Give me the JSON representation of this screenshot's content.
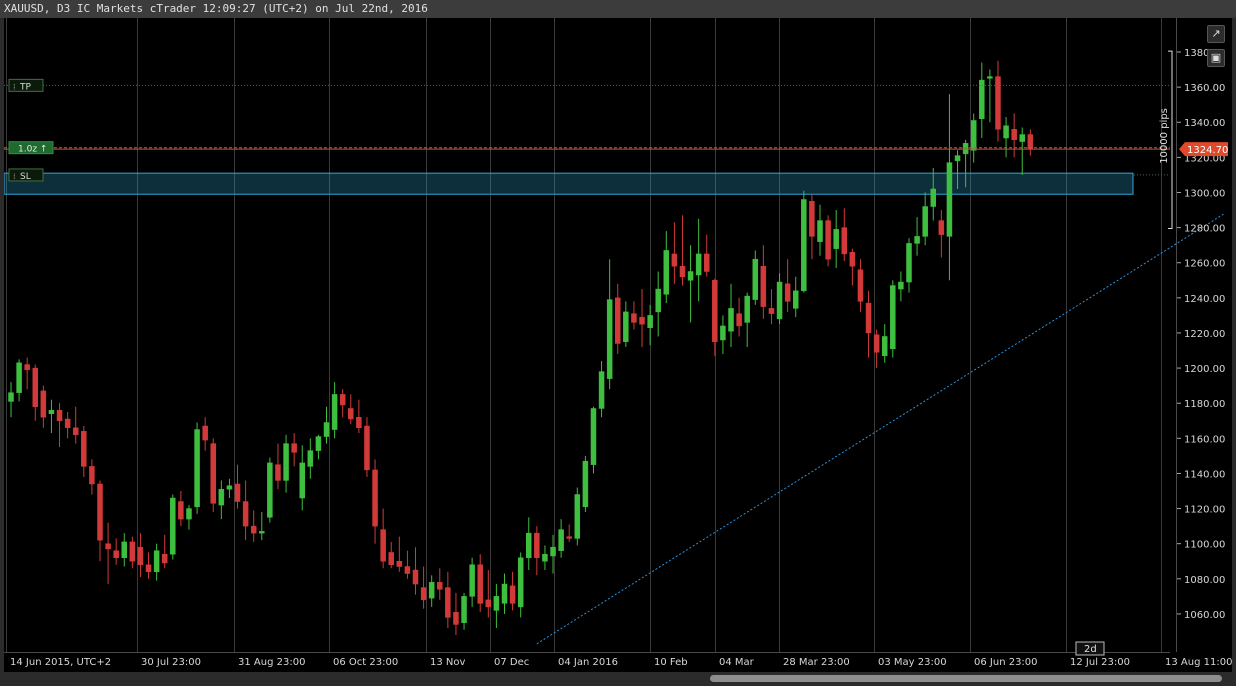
{
  "window": {
    "title": "XAUUSD, D3 IC Markets cTrader 12:09:27 (UTC+2) on Jul 22nd, 2016"
  },
  "colors": {
    "background": "#000000",
    "grid": "#3a3a3a",
    "bull": "#3fbf3f",
    "bear": "#d23a3a",
    "price_line": "#e04a2a",
    "trend": "#2f8fd8",
    "sl_zone": "#2ea8d8"
  },
  "price_axis": {
    "labels": [
      "1380.00",
      "1360.00",
      "1340.00",
      "1320.00",
      "1300.00",
      "1280.00",
      "1260.00",
      "1240.00",
      "1220.00",
      "1200.00",
      "1180.00",
      "1160.00",
      "1140.00",
      "1120.00",
      "1100.00",
      "1080.00",
      "1060.00"
    ],
    "current_price": "1324.70",
    "pips_label": "10000 pips"
  },
  "time_axis": {
    "labels": [
      "14 Jun 2015, UTC+2",
      "30 Jul 23:00",
      "31 Aug 23:00",
      "06 Oct 23:00",
      "13 Nov",
      "07 Dec",
      "04 Jan 2016",
      "10 Feb",
      "04 Mar",
      "28 Mar 23:00",
      "03 May 23:00",
      "06 Jun 23:00",
      "12 Jul 23:00",
      "13 Aug 11:00"
    ],
    "period_badge": "2d"
  },
  "orders": {
    "tp_label": "TP",
    "sl_label": "SL",
    "position_label": "1.0z ↑",
    "tp_price": 1361,
    "sl_top": 1311,
    "sl_bottom": 1299,
    "entry_price": 1325.5
  },
  "toolbar": {
    "popout_icon": "popout-icon",
    "camera_icon": "camera-icon"
  },
  "chart_data": {
    "type": "candlestick",
    "symbol": "XAUUSD",
    "timeframe": "D3",
    "ylim": [
      1045,
      1385
    ],
    "candles": [
      {
        "open": 1181,
        "high": 1192,
        "low": 1172,
        "close": 1186
      },
      {
        "open": 1186,
        "high": 1205,
        "low": 1181,
        "close": 1203
      },
      {
        "open": 1202,
        "high": 1206,
        "low": 1188,
        "close": 1199
      },
      {
        "open": 1200,
        "high": 1202,
        "low": 1170,
        "close": 1178
      },
      {
        "open": 1187,
        "high": 1190,
        "low": 1166,
        "close": 1172
      },
      {
        "open": 1174,
        "high": 1182,
        "low": 1163,
        "close": 1176
      },
      {
        "open": 1176,
        "high": 1180,
        "low": 1155,
        "close": 1170
      },
      {
        "open": 1171,
        "high": 1175,
        "low": 1160,
        "close": 1166
      },
      {
        "open": 1166,
        "high": 1178,
        "low": 1157,
        "close": 1162
      },
      {
        "open": 1164,
        "high": 1167,
        "low": 1138,
        "close": 1144
      },
      {
        "open": 1144,
        "high": 1148,
        "low": 1128,
        "close": 1134
      },
      {
        "open": 1134,
        "high": 1136,
        "low": 1090,
        "close": 1102
      },
      {
        "open": 1100,
        "high": 1112,
        "low": 1077,
        "close": 1097
      },
      {
        "open": 1096,
        "high": 1103,
        "low": 1088,
        "close": 1092
      },
      {
        "open": 1092,
        "high": 1106,
        "low": 1087,
        "close": 1101
      },
      {
        "open": 1101,
        "high": 1104,
        "low": 1086,
        "close": 1090
      },
      {
        "open": 1098,
        "high": 1106,
        "low": 1081,
        "close": 1088
      },
      {
        "open": 1088,
        "high": 1095,
        "low": 1080,
        "close": 1084
      },
      {
        "open": 1084,
        "high": 1100,
        "low": 1079,
        "close": 1096
      },
      {
        "open": 1094,
        "high": 1105,
        "low": 1086,
        "close": 1089
      },
      {
        "open": 1094,
        "high": 1128,
        "low": 1091,
        "close": 1126
      },
      {
        "open": 1124,
        "high": 1130,
        "low": 1110,
        "close": 1114
      },
      {
        "open": 1114,
        "high": 1122,
        "low": 1108,
        "close": 1120
      },
      {
        "open": 1121,
        "high": 1169,
        "low": 1117,
        "close": 1165
      },
      {
        "open": 1167,
        "high": 1172,
        "low": 1153,
        "close": 1159
      },
      {
        "open": 1157,
        "high": 1160,
        "low": 1118,
        "close": 1123
      },
      {
        "open": 1122,
        "high": 1136,
        "low": 1114,
        "close": 1131
      },
      {
        "open": 1131,
        "high": 1137,
        "low": 1126,
        "close": 1133
      },
      {
        "open": 1134,
        "high": 1145,
        "low": 1120,
        "close": 1124
      },
      {
        "open": 1124,
        "high": 1136,
        "low": 1102,
        "close": 1110
      },
      {
        "open": 1110,
        "high": 1119,
        "low": 1101,
        "close": 1106
      },
      {
        "open": 1106,
        "high": 1118,
        "low": 1102,
        "close": 1107
      },
      {
        "open": 1115,
        "high": 1149,
        "low": 1112,
        "close": 1146
      },
      {
        "open": 1145,
        "high": 1157,
        "low": 1131,
        "close": 1136
      },
      {
        "open": 1136,
        "high": 1162,
        "low": 1129,
        "close": 1157
      },
      {
        "open": 1157,
        "high": 1163,
        "low": 1144,
        "close": 1152
      },
      {
        "open": 1126,
        "high": 1156,
        "low": 1119,
        "close": 1146
      },
      {
        "open": 1144,
        "high": 1160,
        "low": 1137,
        "close": 1153
      },
      {
        "open": 1153,
        "high": 1162,
        "low": 1148,
        "close": 1161
      },
      {
        "open": 1161,
        "high": 1178,
        "low": 1157,
        "close": 1169
      },
      {
        "open": 1165,
        "high": 1192,
        "low": 1160,
        "close": 1185
      },
      {
        "open": 1185,
        "high": 1188,
        "low": 1172,
        "close": 1179
      },
      {
        "open": 1177,
        "high": 1185,
        "low": 1168,
        "close": 1171
      },
      {
        "open": 1172,
        "high": 1182,
        "low": 1163,
        "close": 1166
      },
      {
        "open": 1167,
        "high": 1172,
        "low": 1138,
        "close": 1142
      },
      {
        "open": 1142,
        "high": 1148,
        "low": 1100,
        "close": 1110
      },
      {
        "open": 1108,
        "high": 1120,
        "low": 1086,
        "close": 1090
      },
      {
        "open": 1095,
        "high": 1101,
        "low": 1086,
        "close": 1088
      },
      {
        "open": 1090,
        "high": 1104,
        "low": 1084,
        "close": 1087
      },
      {
        "open": 1087,
        "high": 1096,
        "low": 1080,
        "close": 1083
      },
      {
        "open": 1085,
        "high": 1098,
        "low": 1071,
        "close": 1077
      },
      {
        "open": 1075,
        "high": 1087,
        "low": 1063,
        "close": 1068
      },
      {
        "open": 1069,
        "high": 1082,
        "low": 1064,
        "close": 1078
      },
      {
        "open": 1078,
        "high": 1086,
        "low": 1068,
        "close": 1074
      },
      {
        "open": 1075,
        "high": 1084,
        "low": 1052,
        "close": 1058
      },
      {
        "open": 1061,
        "high": 1072,
        "low": 1048,
        "close": 1054
      },
      {
        "open": 1055,
        "high": 1072,
        "low": 1051,
        "close": 1070
      },
      {
        "open": 1070,
        "high": 1092,
        "low": 1064,
        "close": 1088
      },
      {
        "open": 1088,
        "high": 1094,
        "low": 1061,
        "close": 1066
      },
      {
        "open": 1068,
        "high": 1085,
        "low": 1058,
        "close": 1064
      },
      {
        "open": 1062,
        "high": 1077,
        "low": 1052,
        "close": 1070
      },
      {
        "open": 1066,
        "high": 1083,
        "low": 1060,
        "close": 1077
      },
      {
        "open": 1076,
        "high": 1084,
        "low": 1062,
        "close": 1066
      },
      {
        "open": 1064,
        "high": 1095,
        "low": 1058,
        "close": 1092
      },
      {
        "open": 1092,
        "high": 1115,
        "low": 1085,
        "close": 1106
      },
      {
        "open": 1106,
        "high": 1110,
        "low": 1082,
        "close": 1092
      },
      {
        "open": 1090,
        "high": 1099,
        "low": 1085,
        "close": 1094
      },
      {
        "open": 1093,
        "high": 1105,
        "low": 1083,
        "close": 1098
      },
      {
        "open": 1096,
        "high": 1114,
        "low": 1092,
        "close": 1108
      },
      {
        "open": 1104,
        "high": 1111,
        "low": 1101,
        "close": 1103
      },
      {
        "open": 1103,
        "high": 1132,
        "low": 1099,
        "close": 1128
      },
      {
        "open": 1121,
        "high": 1150,
        "low": 1118,
        "close": 1147
      },
      {
        "open": 1145,
        "high": 1178,
        "low": 1140,
        "close": 1177
      },
      {
        "open": 1177,
        "high": 1204,
        "low": 1172,
        "close": 1198
      },
      {
        "open": 1194,
        "high": 1262,
        "low": 1188,
        "close": 1239
      },
      {
        "open": 1240,
        "high": 1248,
        "low": 1208,
        "close": 1214
      },
      {
        "open": 1215,
        "high": 1238,
        "low": 1212,
        "close": 1232
      },
      {
        "open": 1231,
        "high": 1238,
        "low": 1222,
        "close": 1226
      },
      {
        "open": 1229,
        "high": 1245,
        "low": 1212,
        "close": 1225
      },
      {
        "open": 1223,
        "high": 1236,
        "low": 1213,
        "close": 1230
      },
      {
        "open": 1232,
        "high": 1255,
        "low": 1218,
        "close": 1245
      },
      {
        "open": 1242,
        "high": 1278,
        "low": 1237,
        "close": 1267
      },
      {
        "open": 1265,
        "high": 1283,
        "low": 1248,
        "close": 1258
      },
      {
        "open": 1258,
        "high": 1287,
        "low": 1247,
        "close": 1252
      },
      {
        "open": 1250,
        "high": 1270,
        "low": 1226,
        "close": 1255
      },
      {
        "open": 1253,
        "high": 1285,
        "low": 1238,
        "close": 1265
      },
      {
        "open": 1265,
        "high": 1276,
        "low": 1252,
        "close": 1255
      },
      {
        "open": 1250,
        "high": 1251,
        "low": 1207,
        "close": 1215
      },
      {
        "open": 1216,
        "high": 1230,
        "low": 1208,
        "close": 1224
      },
      {
        "open": 1221,
        "high": 1248,
        "low": 1212,
        "close": 1234
      },
      {
        "open": 1231,
        "high": 1240,
        "low": 1218,
        "close": 1224
      },
      {
        "open": 1226,
        "high": 1243,
        "low": 1212,
        "close": 1241
      },
      {
        "open": 1239,
        "high": 1267,
        "low": 1236,
        "close": 1262
      },
      {
        "open": 1258,
        "high": 1270,
        "low": 1228,
        "close": 1235
      },
      {
        "open": 1234,
        "high": 1245,
        "low": 1225,
        "close": 1231
      },
      {
        "open": 1228,
        "high": 1254,
        "low": 1225,
        "close": 1249
      },
      {
        "open": 1248,
        "high": 1262,
        "low": 1232,
        "close": 1238
      },
      {
        "open": 1234,
        "high": 1252,
        "low": 1229,
        "close": 1244
      },
      {
        "open": 1244,
        "high": 1301,
        "low": 1243,
        "close": 1296
      },
      {
        "open": 1295,
        "high": 1299,
        "low": 1262,
        "close": 1275
      },
      {
        "open": 1272,
        "high": 1293,
        "low": 1264,
        "close": 1284
      },
      {
        "open": 1284,
        "high": 1287,
        "low": 1258,
        "close": 1262
      },
      {
        "open": 1268,
        "high": 1290,
        "low": 1257,
        "close": 1279
      },
      {
        "open": 1280,
        "high": 1291,
        "low": 1261,
        "close": 1265
      },
      {
        "open": 1266,
        "high": 1268,
        "low": 1247,
        "close": 1258
      },
      {
        "open": 1256,
        "high": 1262,
        "low": 1232,
        "close": 1238
      },
      {
        "open": 1237,
        "high": 1244,
        "low": 1206,
        "close": 1220
      },
      {
        "open": 1219,
        "high": 1222,
        "low": 1200,
        "close": 1209
      },
      {
        "open": 1207,
        "high": 1225,
        "low": 1203,
        "close": 1218
      },
      {
        "open": 1211,
        "high": 1250,
        "low": 1206,
        "close": 1247
      },
      {
        "open": 1245,
        "high": 1255,
        "low": 1238,
        "close": 1249
      },
      {
        "open": 1249,
        "high": 1274,
        "low": 1243,
        "close": 1271
      },
      {
        "open": 1271,
        "high": 1286,
        "low": 1264,
        "close": 1275
      },
      {
        "open": 1275,
        "high": 1300,
        "low": 1270,
        "close": 1292
      },
      {
        "open": 1292,
        "high": 1314,
        "low": 1284,
        "close": 1302
      },
      {
        "open": 1284,
        "high": 1290,
        "low": 1263,
        "close": 1276
      },
      {
        "open": 1275,
        "high": 1356,
        "low": 1250,
        "close": 1317
      },
      {
        "open": 1318,
        "high": 1324,
        "low": 1302,
        "close": 1321
      },
      {
        "open": 1322,
        "high": 1330,
        "low": 1303,
        "close": 1328
      },
      {
        "open": 1324,
        "high": 1345,
        "low": 1317,
        "close": 1341
      },
      {
        "open": 1342,
        "high": 1374,
        "low": 1331,
        "close": 1364
      },
      {
        "open": 1365,
        "high": 1370,
        "low": 1340,
        "close": 1366
      },
      {
        "open": 1366,
        "high": 1375,
        "low": 1329,
        "close": 1336
      },
      {
        "open": 1331,
        "high": 1343,
        "low": 1320,
        "close": 1338
      },
      {
        "open": 1336,
        "high": 1345,
        "low": 1320,
        "close": 1330
      },
      {
        "open": 1329,
        "high": 1337,
        "low": 1310,
        "close": 1333
      },
      {
        "open": 1333,
        "high": 1336,
        "low": 1321,
        "close": 1325
      }
    ],
    "trendline": {
      "from": {
        "index": 65,
        "price": 1043
      },
      "to": {
        "index": 150,
        "price": 1288
      }
    }
  }
}
